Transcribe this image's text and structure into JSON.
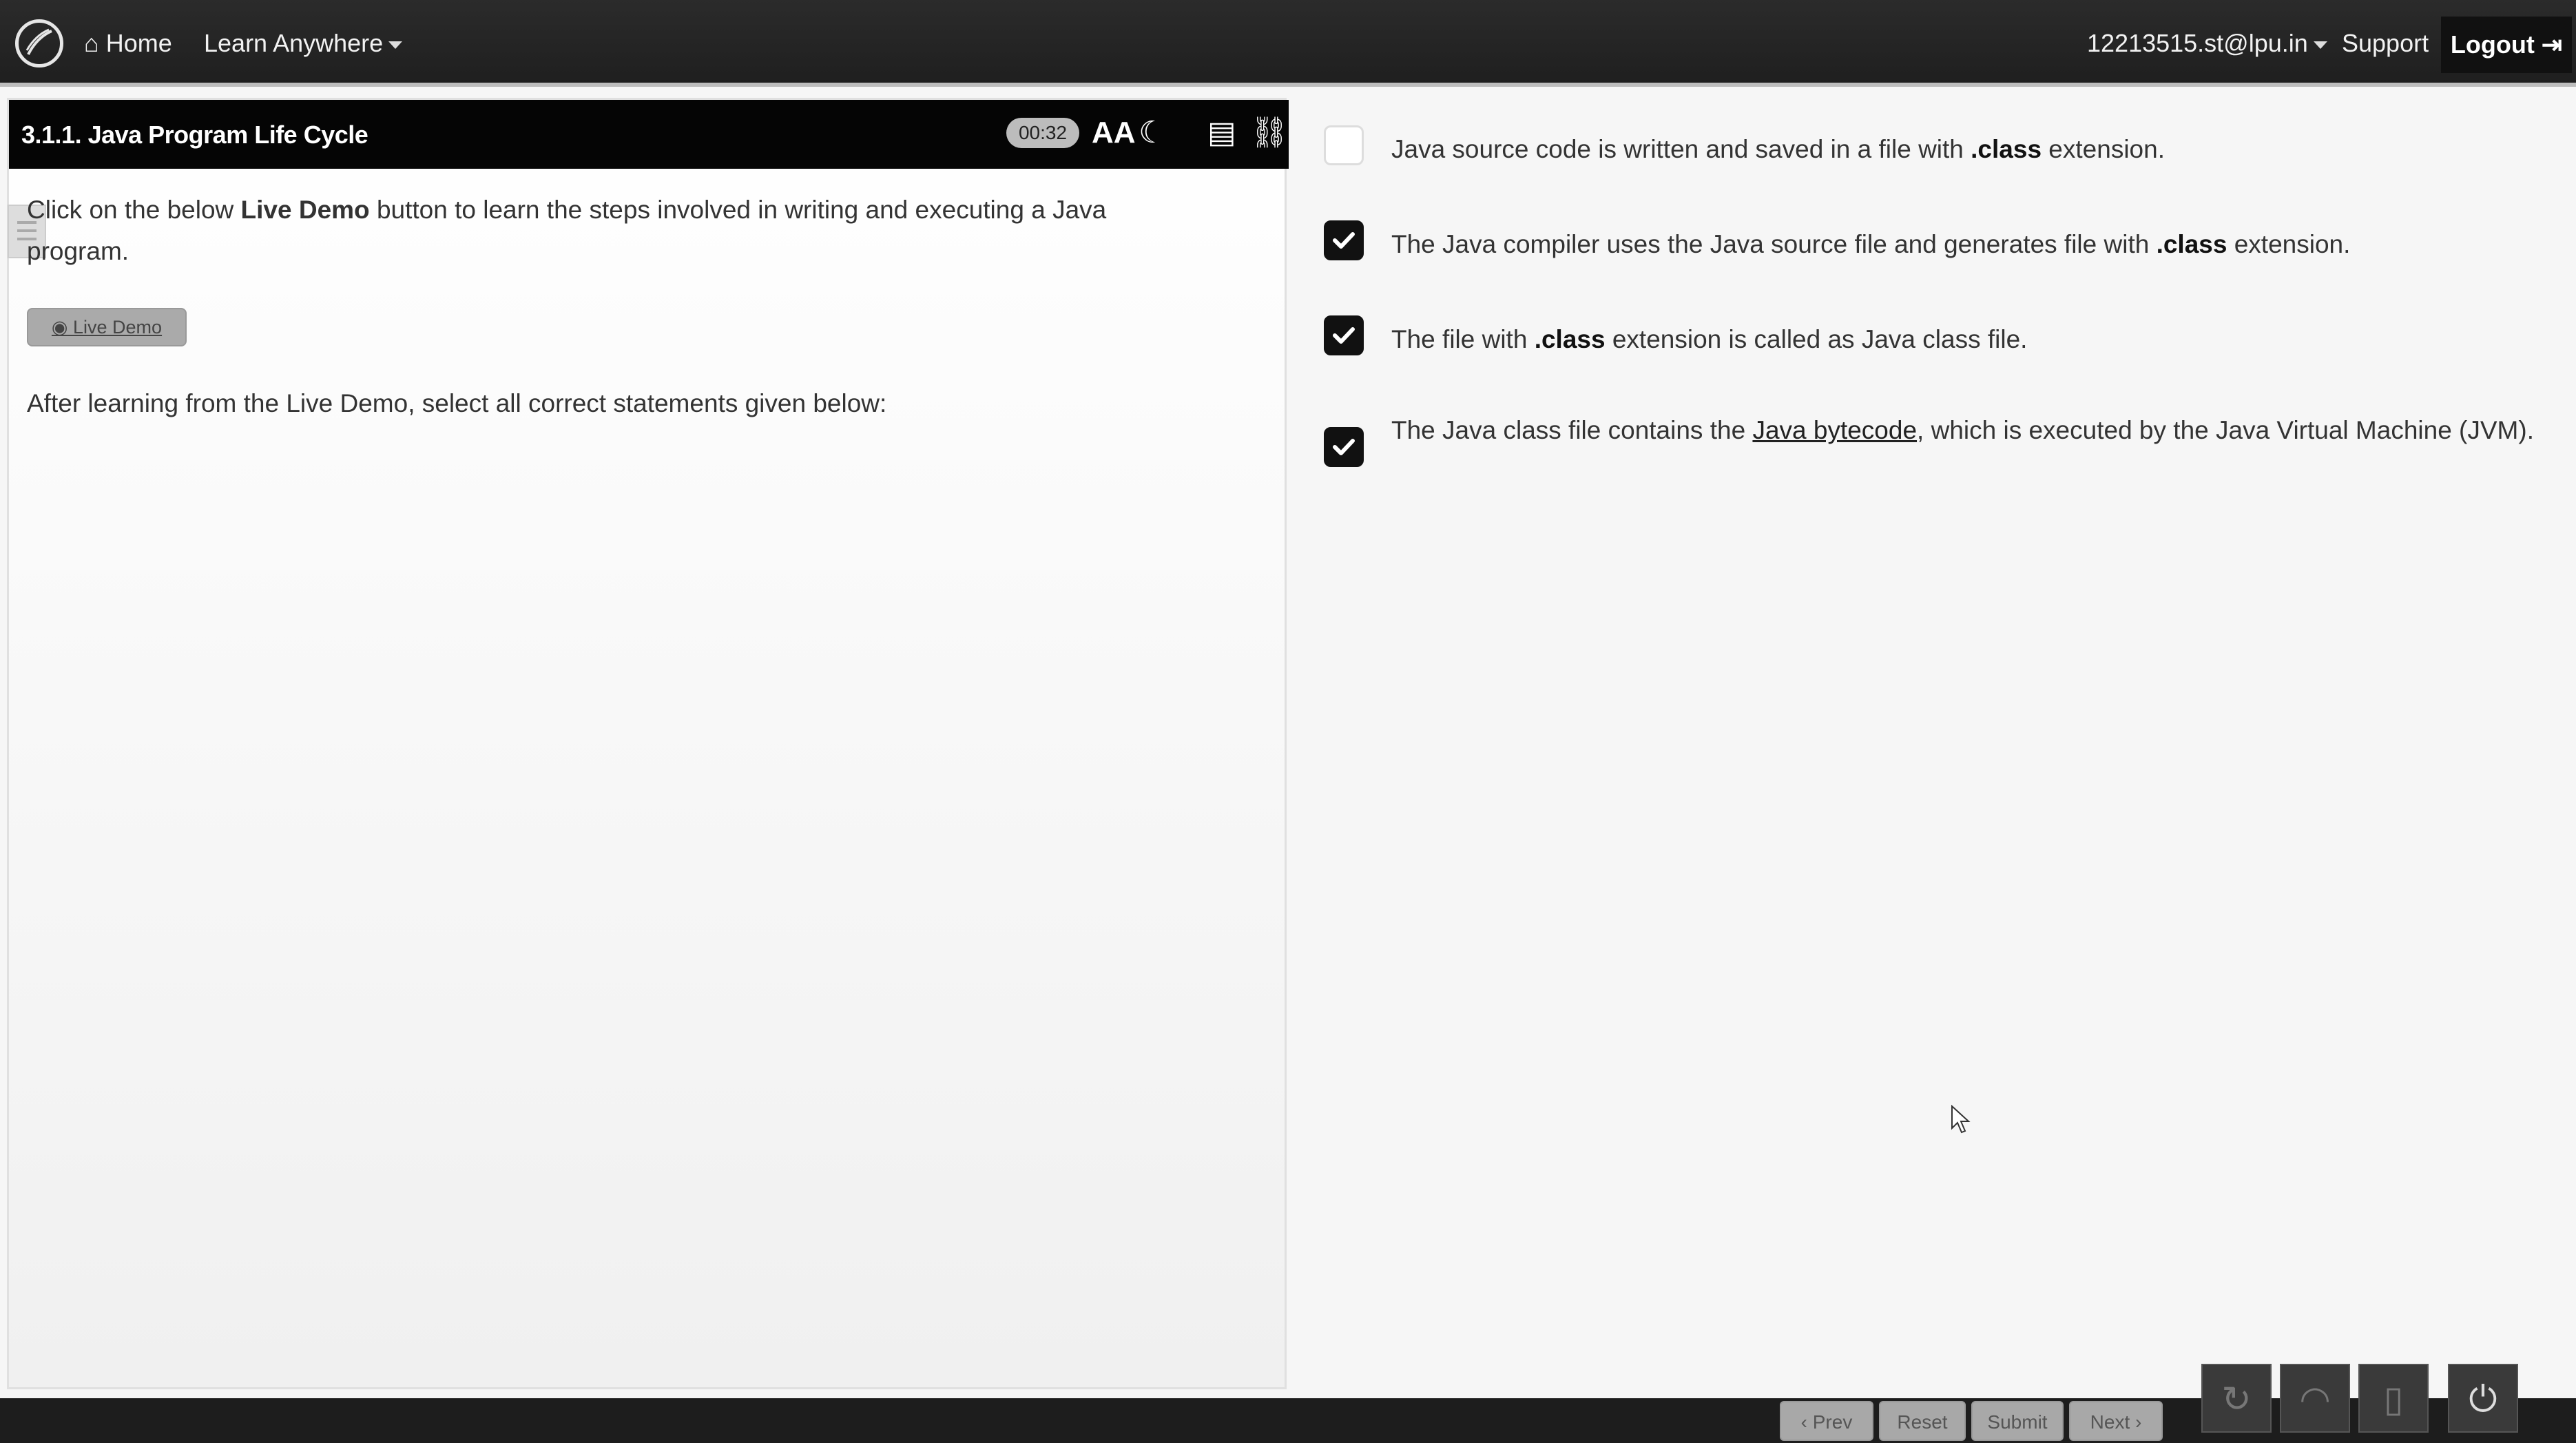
{
  "nav": {
    "home": "Home",
    "learn_anywhere": "Learn Anywhere",
    "user": "12213515.st@lpu.in",
    "support": "Support",
    "logout": "Logout"
  },
  "lesson": {
    "title": "3.1.1. Java Program Life Cycle",
    "timer": "00:32",
    "intro_pre": "Click on the below ",
    "intro_bold": "Live Demo",
    "intro_post": " button to learn the steps involved in writing and executing a Java program.",
    "live_demo_button": "Live Demo",
    "instruction": "After learning from the Live Demo, select all correct statements given below:"
  },
  "statements": [
    {
      "checked": false,
      "pre": "Java source code is written and saved in a file with ",
      "bold": ".class",
      "post": " extension."
    },
    {
      "checked": true,
      "pre": "The Java compiler uses the Java source file and generates file with ",
      "bold": ".class",
      "post": " extension."
    },
    {
      "checked": true,
      "pre": "The file with ",
      "bold": ".class",
      "post": " extension is called as Java class file."
    },
    {
      "checked": true,
      "pre": "The Java class file contains the ",
      "link": "Java bytecode",
      "post": ", which is executed by the Java Virtual Machine (JVM)."
    }
  ],
  "footer": {
    "prev": "‹ Prev",
    "reset": "Reset",
    "submit": "Submit",
    "next": "Next ›"
  },
  "colors": {
    "navbar": "#222222",
    "checked": "#111111",
    "button_disabled": "#a8a8a8"
  }
}
